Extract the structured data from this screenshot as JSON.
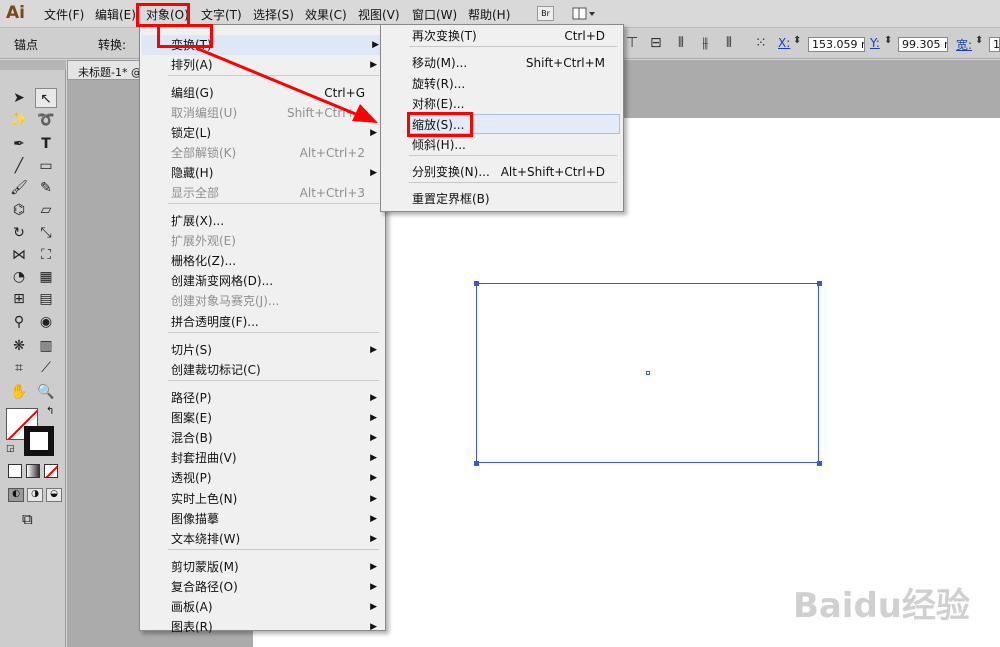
{
  "app": {
    "logo": "Ai"
  },
  "menubar": [
    "文件(F)",
    "编辑(E)",
    "对象(O)",
    "文字(T)",
    "选择(S)",
    "效果(C)",
    "视图(V)",
    "窗口(W)",
    "帮助(H)"
  ],
  "menubar_extras": {
    "bridge": "Br"
  },
  "control_bar": {
    "anchor_label": "锚点",
    "convert_label": "转换:",
    "x_label": "X:",
    "x_value": "153.059 m",
    "y_label": "Y:",
    "y_value": "99.305 mm",
    "w_label": "宽:",
    "w_value": "1"
  },
  "document": {
    "tab_title": "未标题-1* @"
  },
  "object_menu": {
    "groups": [
      [
        {
          "label": "变换(T)",
          "shortcut": "",
          "submenu": true,
          "enabled": true
        },
        {
          "label": "排列(A)",
          "shortcut": "",
          "submenu": true,
          "enabled": true
        }
      ],
      [
        {
          "label": "编组(G)",
          "shortcut": "Ctrl+G",
          "submenu": false,
          "enabled": true
        },
        {
          "label": "取消编组(U)",
          "shortcut": "Shift+Ctrl+G",
          "submenu": false,
          "enabled": false
        },
        {
          "label": "锁定(L)",
          "shortcut": "",
          "submenu": true,
          "enabled": true
        },
        {
          "label": "全部解锁(K)",
          "shortcut": "Alt+Ctrl+2",
          "submenu": false,
          "enabled": false
        },
        {
          "label": "隐藏(H)",
          "shortcut": "",
          "submenu": true,
          "enabled": true
        },
        {
          "label": "显示全部",
          "shortcut": "Alt+Ctrl+3",
          "submenu": false,
          "enabled": false
        }
      ],
      [
        {
          "label": "扩展(X)...",
          "shortcut": "",
          "submenu": false,
          "enabled": true
        },
        {
          "label": "扩展外观(E)",
          "shortcut": "",
          "submenu": false,
          "enabled": false
        },
        {
          "label": "栅格化(Z)...",
          "shortcut": "",
          "submenu": false,
          "enabled": true
        },
        {
          "label": "创建渐变网格(D)...",
          "shortcut": "",
          "submenu": false,
          "enabled": true
        },
        {
          "label": "创建对象马赛克(J)...",
          "shortcut": "",
          "submenu": false,
          "enabled": false
        },
        {
          "label": "拼合透明度(F)...",
          "shortcut": "",
          "submenu": false,
          "enabled": true
        }
      ],
      [
        {
          "label": "切片(S)",
          "shortcut": "",
          "submenu": true,
          "enabled": true
        },
        {
          "label": "创建裁切标记(C)",
          "shortcut": "",
          "submenu": false,
          "enabled": true
        }
      ],
      [
        {
          "label": "路径(P)",
          "shortcut": "",
          "submenu": true,
          "enabled": true
        },
        {
          "label": "图案(E)",
          "shortcut": "",
          "submenu": true,
          "enabled": true
        },
        {
          "label": "混合(B)",
          "shortcut": "",
          "submenu": true,
          "enabled": true
        },
        {
          "label": "封套扭曲(V)",
          "shortcut": "",
          "submenu": true,
          "enabled": true
        },
        {
          "label": "透视(P)",
          "shortcut": "",
          "submenu": true,
          "enabled": true
        },
        {
          "label": "实时上色(N)",
          "shortcut": "",
          "submenu": true,
          "enabled": true
        },
        {
          "label": "图像描摹",
          "shortcut": "",
          "submenu": true,
          "enabled": true
        },
        {
          "label": "文本绕排(W)",
          "shortcut": "",
          "submenu": true,
          "enabled": true
        }
      ],
      [
        {
          "label": "剪切蒙版(M)",
          "shortcut": "",
          "submenu": true,
          "enabled": true
        },
        {
          "label": "复合路径(O)",
          "shortcut": "",
          "submenu": true,
          "enabled": true
        },
        {
          "label": "画板(A)",
          "shortcut": "",
          "submenu": true,
          "enabled": true
        },
        {
          "label": "图表(R)",
          "shortcut": "",
          "submenu": true,
          "enabled": true
        }
      ]
    ]
  },
  "transform_submenu": {
    "groups": [
      [
        {
          "label": "再次变换(T)",
          "shortcut": "Ctrl+D"
        }
      ],
      [
        {
          "label": "移动(M)...",
          "shortcut": "Shift+Ctrl+M"
        },
        {
          "label": "旋转(R)...",
          "shortcut": ""
        },
        {
          "label": "对称(E)...",
          "shortcut": ""
        },
        {
          "label": "缩放(S)...",
          "shortcut": ""
        },
        {
          "label": "倾斜(H)...",
          "shortcut": ""
        }
      ],
      [
        {
          "label": "分别变换(N)...",
          "shortcut": "Alt+Shift+Ctrl+D"
        }
      ],
      [
        {
          "label": "重置定界框(B)",
          "shortcut": ""
        }
      ]
    ]
  },
  "watermark": {
    "text": "Baidu经验"
  },
  "colors": {
    "highlight": "#ff0000",
    "selection": "#3b59c9",
    "menu_bg": "#f0f0f0",
    "hover": "#dde7f6"
  }
}
